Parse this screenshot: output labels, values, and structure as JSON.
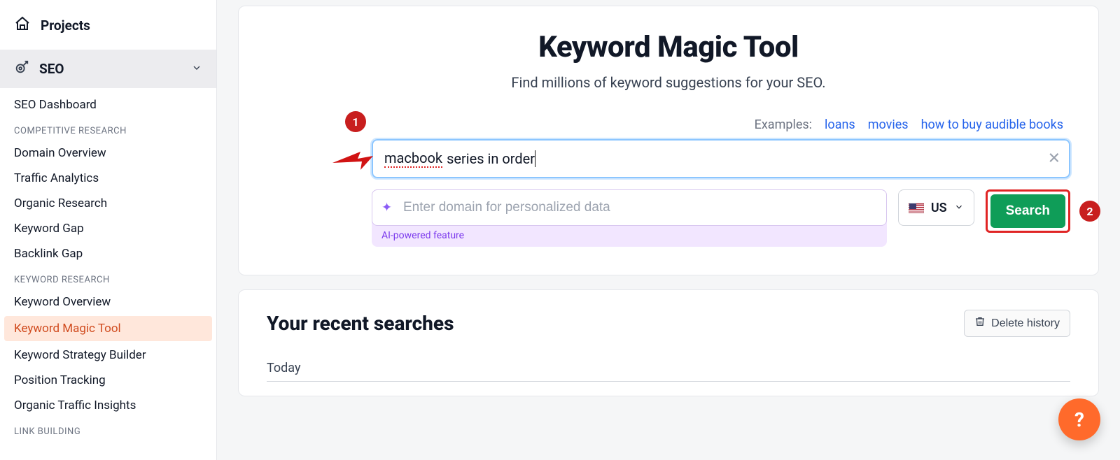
{
  "sidebar": {
    "projects_label": "Projects",
    "seo_label": "SEO",
    "links": {
      "seo_dashboard": "SEO Dashboard",
      "competitive_h": "COMPETITIVE RESEARCH",
      "domain_overview": "Domain Overview",
      "traffic_analytics": "Traffic Analytics",
      "organic_research": "Organic Research",
      "keyword_gap": "Keyword Gap",
      "backlink_gap": "Backlink Gap",
      "keyword_h": "KEYWORD RESEARCH",
      "keyword_overview": "Keyword Overview",
      "keyword_magic_tool": "Keyword Magic Tool",
      "keyword_strategy": "Keyword Strategy Builder",
      "position_tracking": "Position Tracking",
      "organic_traffic": "Organic Traffic Insights",
      "link_building_h": "LINK BUILDING"
    }
  },
  "main": {
    "title": "Keyword Magic Tool",
    "subtitle": "Find millions of keyword suggestions for your SEO.",
    "examples_hint": "Examples:",
    "examples": {
      "e1": "loans",
      "e2": "movies",
      "e3": "how to buy audible books"
    },
    "keyword_value_word1": "macbook",
    "keyword_value_rest": "series in order",
    "domain_placeholder": "Enter domain for personalized data",
    "ai_note": "AI-powered feature",
    "country_code": "US",
    "search_label": "Search"
  },
  "recent": {
    "title": "Your recent searches",
    "delete_label": "Delete history",
    "today": "Today"
  },
  "annotations": {
    "badge1": "1",
    "badge2": "2"
  },
  "fab": {
    "label": "?"
  }
}
